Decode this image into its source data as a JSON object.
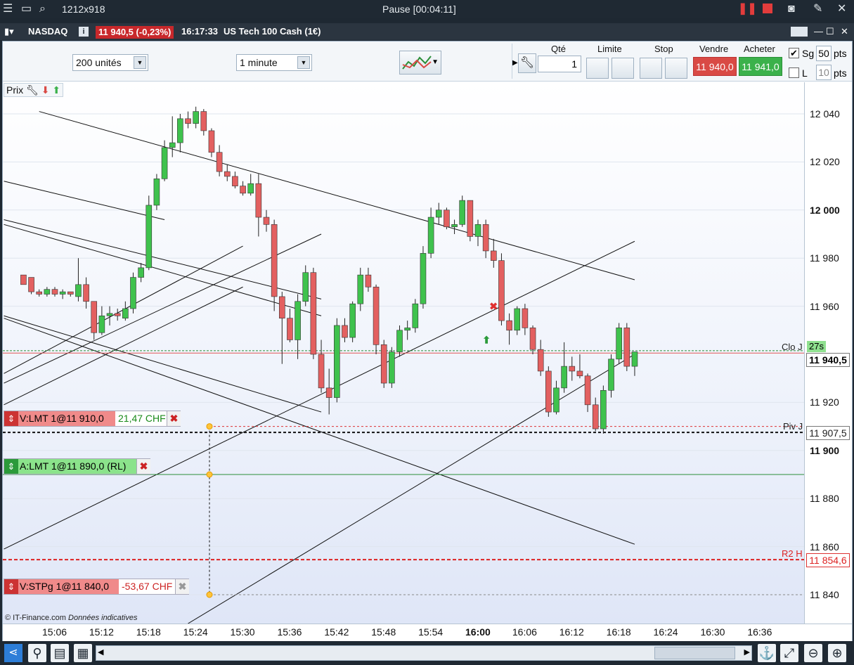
{
  "titlebar": {
    "resolution": "1212x918",
    "status": "Pause [00:04:11]"
  },
  "instrument": {
    "market": "NASDAQ",
    "price": "11 940,5 (-0,23%)",
    "time": "16:17:33",
    "name": "US Tech 100 Cash (1€)"
  },
  "toolbar": {
    "units": "200 unités",
    "interval": "1 minute",
    "qty_label": "Qté",
    "qty_value": "1",
    "limit_label": "Limite",
    "stop_label": "Stop",
    "sell_label": "Vendre",
    "buy_label": "Acheter",
    "sell_price": "11 940,0",
    "buy_price": "11 941,0",
    "sg_label": "Sg",
    "sg_value": "50",
    "pts_label": "pts",
    "l_label": "L",
    "l_value": "10",
    "pts2_label": "pts",
    "prix_label": "Prix"
  },
  "colors": {
    "bull": "#3fc24d",
    "bear": "#e36060",
    "sell_bg": "#d94a45",
    "buy_bg": "#3bb14b",
    "title_bg": "#1f2933",
    "chart_bg_bottom": "#dfe6f7",
    "order_sell": "#f08a8a",
    "order_buy": "#8be38b"
  },
  "orders": {
    "sell_limit": {
      "label": "V:LMT  1@11 910,0",
      "pl": "21,47 CHF"
    },
    "buy_limit": {
      "label": "A:LMT  1@11 890,0 (RL)"
    },
    "sell_stop": {
      "label": "V:STPg  1@11 840,0",
      "pl": "-53,67 CHF"
    }
  },
  "axis_labels": {
    "clo": "Clo J",
    "clo_timer": "27s",
    "piv": "Piv J",
    "r2": "R2 H",
    "current": "11 940,5",
    "piv_value": "11 907,5",
    "r2_value": "11 854,6",
    "credit": "© IT-Finance.com",
    "credit_note": "Données indicatives"
  },
  "chart_data": {
    "type": "candlestick",
    "yticks": [
      "12 040",
      "12 020",
      "12 000",
      "11 980",
      "11 960",
      "11 920",
      "11 900",
      "11 880",
      "11 860",
      "11 840"
    ],
    "ylim": [
      11829,
      12061
    ],
    "xticks": [
      "15:06",
      "15:12",
      "15:18",
      "15:24",
      "15:30",
      "15:36",
      "15:42",
      "15:48",
      "15:54",
      "16:00",
      "16:06",
      "16:12",
      "16:18",
      "16:24",
      "16:30",
      "16:36"
    ],
    "candles": [
      {
        "t": "15:02",
        "o": 11973,
        "h": 11973,
        "l": 11970,
        "c": 11969
      },
      {
        "t": "15:03",
        "o": 11972,
        "h": 11972,
        "l": 11965,
        "c": 11966
      },
      {
        "t": "15:04",
        "o": 11966,
        "h": 11967,
        "l": 11964,
        "c": 11965
      },
      {
        "t": "15:05",
        "o": 11965,
        "h": 11968,
        "l": 11964,
        "c": 11967
      },
      {
        "t": "15:06",
        "o": 11967,
        "h": 11968,
        "l": 11964,
        "c": 11965
      },
      {
        "t": "15:07",
        "o": 11965,
        "h": 11967,
        "l": 11963,
        "c": 11966
      },
      {
        "t": "15:08",
        "o": 11966,
        "h": 11966,
        "l": 11964,
        "c": 11965
      },
      {
        "t": "15:09",
        "o": 11964,
        "h": 11980,
        "l": 11962,
        "c": 11969
      },
      {
        "t": "15:10",
        "o": 11969,
        "h": 11972,
        "l": 11959,
        "c": 11962
      },
      {
        "t": "15:11",
        "o": 11962,
        "h": 11962,
        "l": 11946,
        "c": 11949
      },
      {
        "t": "15:12",
        "o": 11949,
        "h": 11960,
        "l": 11948,
        "c": 11956
      },
      {
        "t": "15:13",
        "o": 11956,
        "h": 11960,
        "l": 11952,
        "c": 11957
      },
      {
        "t": "15:14",
        "o": 11957,
        "h": 11959,
        "l": 11954,
        "c": 11956
      },
      {
        "t": "15:15",
        "o": 11955,
        "h": 11962,
        "l": 11954,
        "c": 11959
      },
      {
        "t": "15:16",
        "o": 11959,
        "h": 11974,
        "l": 11957,
        "c": 11972
      },
      {
        "t": "15:17",
        "o": 11972,
        "h": 11978,
        "l": 11970,
        "c": 11976
      },
      {
        "t": "15:18",
        "o": 11976,
        "h": 12006,
        "l": 11975,
        "c": 12002
      },
      {
        "t": "15:19",
        "o": 12002,
        "h": 12015,
        "l": 12000,
        "c": 12013
      },
      {
        "t": "15:20",
        "o": 12013,
        "h": 12029,
        "l": 12012,
        "c": 12026
      },
      {
        "t": "15:21",
        "o": 12026,
        "h": 12039,
        "l": 12022,
        "c": 12028
      },
      {
        "t": "15:22",
        "o": 12028,
        "h": 12040,
        "l": 12024,
        "c": 12038
      },
      {
        "t": "15:23",
        "o": 12038,
        "h": 12041,
        "l": 12034,
        "c": 12036
      },
      {
        "t": "15:24",
        "o": 12036,
        "h": 12043,
        "l": 12034,
        "c": 12041
      },
      {
        "t": "15:25",
        "o": 12041,
        "h": 12042,
        "l": 12031,
        "c": 12033
      },
      {
        "t": "15:26",
        "o": 12033,
        "h": 12034,
        "l": 12022,
        "c": 12024
      },
      {
        "t": "15:27",
        "o": 12024,
        "h": 12027,
        "l": 12014,
        "c": 12016
      },
      {
        "t": "15:28",
        "o": 12016,
        "h": 12019,
        "l": 12012,
        "c": 12014
      },
      {
        "t": "15:29",
        "o": 12014,
        "h": 12016,
        "l": 12009,
        "c": 12010
      },
      {
        "t": "15:30",
        "o": 12010,
        "h": 12012,
        "l": 12006,
        "c": 12007
      },
      {
        "t": "15:31",
        "o": 12007,
        "h": 12015,
        "l": 12006,
        "c": 12011
      },
      {
        "t": "15:32",
        "o": 12011,
        "h": 12015,
        "l": 11989,
        "c": 11997
      },
      {
        "t": "15:33",
        "o": 11997,
        "h": 12000,
        "l": 11991,
        "c": 11994
      },
      {
        "t": "15:34",
        "o": 11994,
        "h": 11996,
        "l": 11958,
        "c": 11964
      },
      {
        "t": "15:35",
        "o": 11964,
        "h": 11966,
        "l": 11936,
        "c": 11955
      },
      {
        "t": "15:36",
        "o": 11955,
        "h": 11959,
        "l": 11945,
        "c": 11946
      },
      {
        "t": "15:37",
        "o": 11946,
        "h": 11965,
        "l": 11938,
        "c": 11962
      },
      {
        "t": "15:38",
        "o": 11962,
        "h": 11977,
        "l": 11960,
        "c": 11974
      },
      {
        "t": "15:39",
        "o": 11974,
        "h": 11976,
        "l": 11938,
        "c": 11940
      },
      {
        "t": "15:40",
        "o": 11940,
        "h": 11946,
        "l": 11924,
        "c": 11926
      },
      {
        "t": "15:41",
        "o": 11926,
        "h": 11934,
        "l": 11915,
        "c": 11922
      },
      {
        "t": "15:42",
        "o": 11922,
        "h": 11955,
        "l": 11920,
        "c": 11952
      },
      {
        "t": "15:43",
        "o": 11952,
        "h": 11955,
        "l": 11945,
        "c": 11947
      },
      {
        "t": "15:44",
        "o": 11947,
        "h": 11962,
        "l": 11945,
        "c": 11961
      },
      {
        "t": "15:45",
        "o": 11961,
        "h": 11976,
        "l": 11958,
        "c": 11973
      },
      {
        "t": "15:46",
        "o": 11973,
        "h": 11976,
        "l": 11966,
        "c": 11968
      },
      {
        "t": "15:47",
        "o": 11968,
        "h": 11969,
        "l": 11940,
        "c": 11944
      },
      {
        "t": "15:48",
        "o": 11944,
        "h": 11946,
        "l": 11926,
        "c": 11928
      },
      {
        "t": "15:49",
        "o": 11928,
        "h": 11943,
        "l": 11926,
        "c": 11941
      },
      {
        "t": "15:50",
        "o": 11941,
        "h": 11952,
        "l": 11939,
        "c": 11950
      },
      {
        "t": "15:51",
        "o": 11950,
        "h": 11954,
        "l": 11946,
        "c": 11951
      },
      {
        "t": "15:52",
        "o": 11951,
        "h": 11963,
        "l": 11949,
        "c": 11961
      },
      {
        "t": "15:53",
        "o": 11961,
        "h": 11985,
        "l": 11959,
        "c": 11982
      },
      {
        "t": "15:54",
        "o": 11982,
        "h": 12001,
        "l": 11980,
        "c": 11997
      },
      {
        "t": "15:55",
        "o": 11997,
        "h": 12003,
        "l": 11994,
        "c": 12000
      },
      {
        "t": "15:56",
        "o": 12000,
        "h": 12001,
        "l": 11992,
        "c": 11993
      },
      {
        "t": "15:57",
        "o": 11993,
        "h": 11996,
        "l": 11990,
        "c": 11994
      },
      {
        "t": "15:58",
        "o": 11994,
        "h": 12006,
        "l": 11993,
        "c": 12004
      },
      {
        "t": "15:59",
        "o": 12004,
        "h": 12004,
        "l": 11987,
        "c": 11989
      },
      {
        "t": "16:00",
        "o": 11989,
        "h": 11996,
        "l": 11985,
        "c": 11994
      },
      {
        "t": "16:01",
        "o": 11994,
        "h": 11996,
        "l": 11980,
        "c": 11983
      },
      {
        "t": "16:02",
        "o": 11983,
        "h": 11988,
        "l": 11976,
        "c": 11979
      },
      {
        "t": "16:03",
        "o": 11979,
        "h": 11982,
        "l": 11952,
        "c": 11954
      },
      {
        "t": "16:04",
        "o": 11954,
        "h": 11957,
        "l": 11944,
        "c": 11950
      },
      {
        "t": "16:05",
        "o": 11950,
        "h": 11960,
        "l": 11948,
        "c": 11959
      },
      {
        "t": "16:06",
        "o": 11959,
        "h": 11961,
        "l": 11948,
        "c": 11951
      },
      {
        "t": "16:07",
        "o": 11951,
        "h": 11952,
        "l": 11940,
        "c": 11942
      },
      {
        "t": "16:08",
        "o": 11942,
        "h": 11946,
        "l": 11931,
        "c": 11933
      },
      {
        "t": "16:09",
        "o": 11933,
        "h": 11935,
        "l": 11914,
        "c": 11916
      },
      {
        "t": "16:10",
        "o": 11916,
        "h": 11929,
        "l": 11915,
        "c": 11926
      },
      {
        "t": "16:11",
        "o": 11926,
        "h": 11945,
        "l": 11924,
        "c": 11935
      },
      {
        "t": "16:12",
        "o": 11935,
        "h": 11939,
        "l": 11929,
        "c": 11933
      },
      {
        "t": "16:13",
        "o": 11933,
        "h": 11940,
        "l": 11930,
        "c": 11931
      },
      {
        "t": "16:14",
        "o": 11931,
        "h": 11932,
        "l": 11916,
        "c": 11919
      },
      {
        "t": "16:15",
        "o": 11919,
        "h": 11922,
        "l": 11908,
        "c": 11909
      },
      {
        "t": "16:16",
        "o": 11909,
        "h": 11927,
        "l": 11907,
        "c": 11925
      },
      {
        "t": "16:17",
        "o": 11925,
        "h": 11940,
        "l": 11922,
        "c": 11938
      },
      {
        "t": "16:18",
        "o": 11938,
        "h": 11953,
        "l": 11936,
        "c": 11951
      },
      {
        "t": "16:19",
        "o": 11951,
        "h": 11953,
        "l": 11933,
        "c": 11935
      },
      {
        "t": "16:20",
        "o": 11935,
        "h": 11941,
        "l": 11931,
        "c": 11941
      }
    ],
    "levels": {
      "current": 11940.5,
      "clo": 11941.5,
      "piv": 11907.5,
      "sell_limit": 11910,
      "buy_limit": 11890,
      "sell_stop": 11840,
      "r2": 11854.6
    }
  }
}
